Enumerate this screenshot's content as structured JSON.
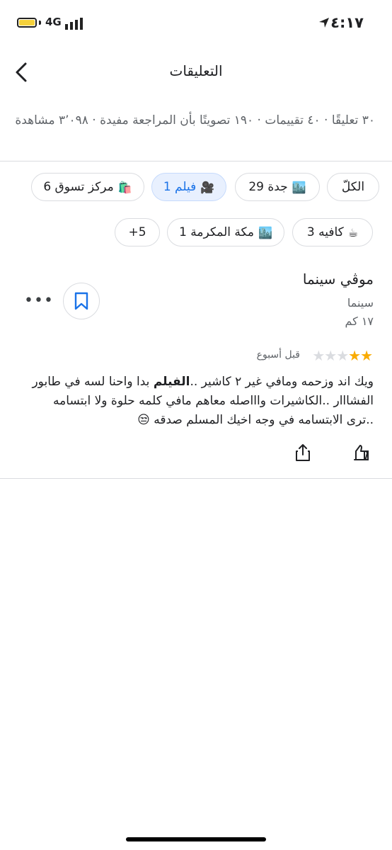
{
  "status": {
    "time": "٤:١٧",
    "network": "4G"
  },
  "header": {
    "title": "التعليقات"
  },
  "stats": {
    "text": "٣٠ تعليقًا · ٤٠ تقييمات · ١٩٠ تصويتًا بأن المراجعة مفيدة · ٣٬٠٩٨ مشاهدة"
  },
  "chips": [
    {
      "label": "الكلّ",
      "emoji": ""
    },
    {
      "label": "جدة 29",
      "emoji": "🏙️"
    },
    {
      "label": "فيلم 1",
      "emoji": "🎥"
    },
    {
      "label": "مركز تسوق 6",
      "emoji": "🛍️"
    },
    {
      "label": "كافيه 3",
      "emoji": "☕"
    },
    {
      "label": "مكة المكرمة 1",
      "emoji": "🏙️"
    },
    {
      "label": "+5",
      "emoji": ""
    }
  ],
  "review": {
    "place_name": "موڤي سينما",
    "category": "سينما",
    "distance": "١٧ كم",
    "rating": 2,
    "rating_max": 5,
    "time_ago": "قبل أسبوع",
    "text_before": "ويك اند وزحمه ومافي غير ٢ كاشير ..",
    "text_bold": "الفيلم",
    "text_after": " بدا واحنا لسه في طابور الفشااار ..الكاشيرات واااصله معاهم مافي كلمه حلوة ولا ابتسامه ..ترى الابتسامه في وجه اخيك المسلم صدقه 😒",
    "more_label": "•••"
  },
  "colors": {
    "accent": "#1a73e8",
    "star": "#f9ab00",
    "selected_chip_bg": "#e8f0fe"
  }
}
